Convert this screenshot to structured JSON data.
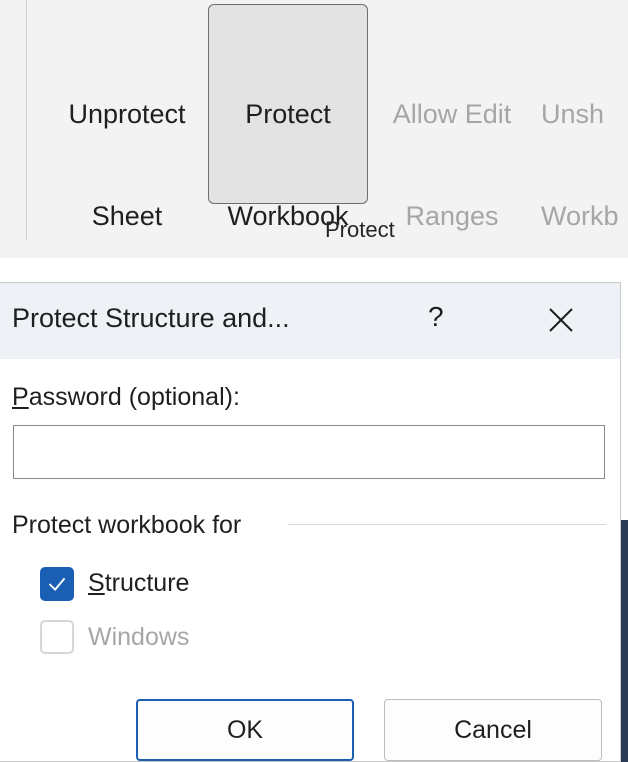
{
  "ribbon": {
    "group_label": "Protect",
    "buttons": [
      {
        "line1": "Unprotect",
        "line2": "Sheet",
        "icon": "sheet-lock-icon",
        "state": "enabled"
      },
      {
        "line1": "Protect",
        "line2": "Workbook",
        "icon": "workbook-lock-icon",
        "state": "active"
      },
      {
        "line1": "Allow Edit",
        "line2": "Ranges",
        "icon": "sheet-pencil-icon",
        "state": "disabled"
      },
      {
        "line1": "Unsh",
        "line2": "Workb",
        "icon": "workbook-user-icon",
        "state": "disabled"
      }
    ]
  },
  "dialog": {
    "title": "Protect Structure and...",
    "help": "?",
    "password": {
      "label_access_key": "P",
      "label_rest": "assword (optional):",
      "value": ""
    },
    "group_label": "Protect workbook for",
    "structure": {
      "access_key": "S",
      "rest": "tructure",
      "checked": true
    },
    "windows": {
      "label": "Windows",
      "checked": false,
      "disabled": true
    },
    "ok_label": "OK",
    "cancel_label": "Cancel"
  },
  "colors": {
    "accent": "#1a5fb4",
    "lock": "#f2b33d",
    "titlebar": "#eef2f7",
    "ribbon": "#f3f3f3",
    "disabled_text": "#a6a6a6"
  }
}
